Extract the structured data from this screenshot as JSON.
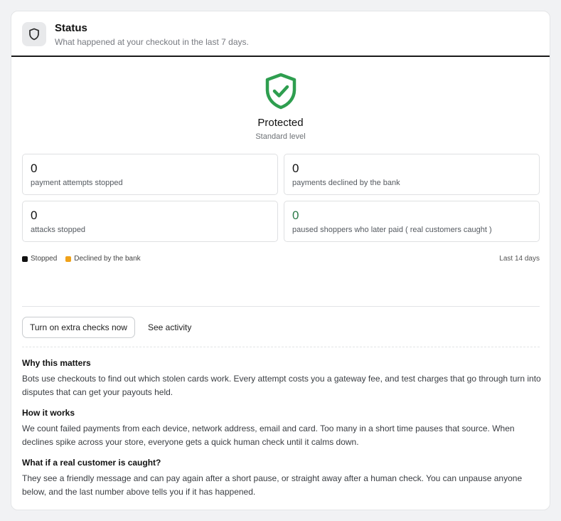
{
  "header": {
    "icon": "shield-icon",
    "title": "Status",
    "subtitle": "What happened at your checkout in the last 7 days."
  },
  "hero": {
    "icon": "shield-check-icon",
    "status": "Protected",
    "level": "Standard level",
    "color": "#2e9e4f"
  },
  "stats": [
    {
      "value": "0",
      "label": "payment attempts stopped"
    },
    {
      "value": "0",
      "label": "payments declined by the bank"
    },
    {
      "value": "0",
      "label": "attacks stopped"
    },
    {
      "value": "0",
      "label": "paused shoppers who later paid ( real customers caught )"
    }
  ],
  "legend": {
    "items": [
      {
        "label": "Stopped",
        "color": "#111111"
      },
      {
        "label": "Declined by the bank",
        "color": "#f0a21a"
      }
    ],
    "range": "Last 14 days"
  },
  "actions": {
    "primary": "Turn on extra checks now",
    "secondary": "See activity"
  },
  "info": [
    {
      "title": "Why this matters",
      "body": "Bots use checkouts to find out which stolen cards work. Every attempt costs you a gateway fee, and test charges that go through turn into disputes that can get your payouts held."
    },
    {
      "title": "How it works",
      "body": "We count failed payments from each device, network address, email and card. Too many in a short time pauses that source. When declines spike across your store, everyone gets a quick human check until it calms down."
    },
    {
      "title": "What if a real customer is caught?",
      "body": "They see a friendly message and can pay again after a short pause, or straight away after a human check. You can unpause anyone below, and the last number above tells you if it has happened."
    }
  ]
}
